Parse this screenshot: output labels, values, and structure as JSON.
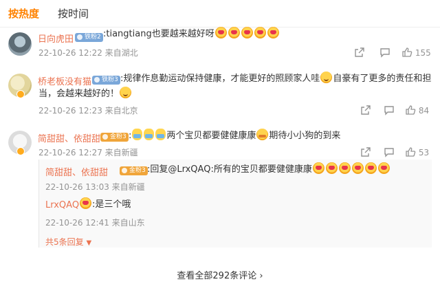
{
  "tabs": {
    "hot": "按热度",
    "time": "按时间"
  },
  "comments": [
    {
      "username": "日向虎田",
      "fan_badge": "铁粉2",
      "text": ":tiangtiang也要越来越好呀",
      "emoji_count": 5,
      "meta": "22-10-26 12:22 来自湖北",
      "likes": "155"
    },
    {
      "username": "桥老板没有猫",
      "fan_badge": "铁粉3",
      "text_line1": ":规律作息勤运动保持健康，才能更好的照顾家人哇",
      "text_line1_end": "自豪有了更多的责任和担",
      "text_line2": "当，会越来越好的！",
      "meta": "22-10-26 12:23 来自北京",
      "likes": "84"
    },
    {
      "username": "简甜甜、依甜甜",
      "fan_badge": "金粉3",
      "text_a": "两个宝贝都要健健康康",
      "text_b": "期待小小狗的到来",
      "meta": "22-10-26 12:27 来自新疆",
      "likes": "53",
      "replies": [
        {
          "username": "简甜甜、依甜甜",
          "fan_badge": "金粉3",
          "text": ":回复@LrxQAQ:所有的宝贝都要健健康康",
          "meta": "22-10-26 13:03 来自新疆"
        },
        {
          "username": "LrxQAQ",
          "text": ":是三个哦",
          "meta": "22-10-26 12:41 来自山东"
        }
      ],
      "more_replies": "共5条回复"
    }
  ],
  "view_all": "查看全部292条评论",
  "colors": {
    "accent": "#ff8200",
    "username": "#eb7350",
    "meta": "#939393"
  }
}
